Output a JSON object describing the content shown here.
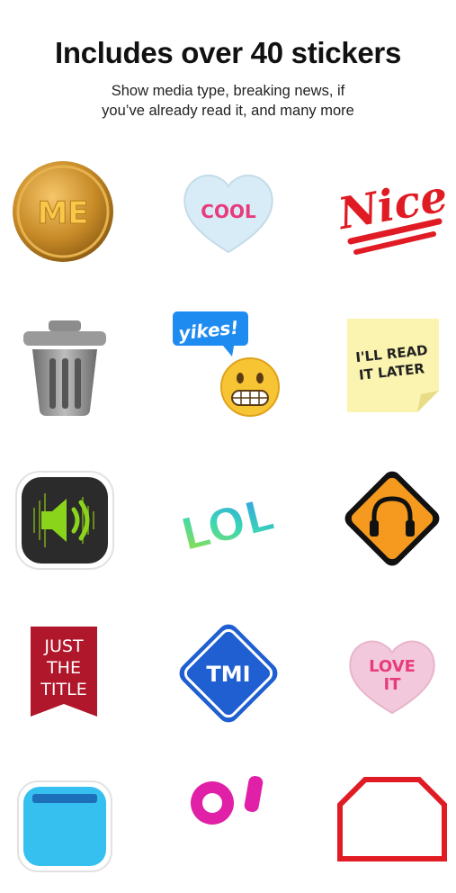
{
  "header": {
    "title": "Includes over 40 stickers",
    "subtitle_line1": "Show media type, breaking news, if",
    "subtitle_line2": "you’ve already read it, and many more"
  },
  "stickers": {
    "me": {
      "text": "ME",
      "icon": "gold-medal-icon"
    },
    "cool": {
      "text": "COOL",
      "icon": "candy-heart-icon"
    },
    "nice": {
      "text": "Nice",
      "icon": "nice-stamp-icon"
    },
    "trash": {
      "icon": "trash-can-icon"
    },
    "yikes": {
      "text": "yikes!",
      "icon": "grimace-emoji-icon"
    },
    "read_later": {
      "line1": "I'LL READ",
      "line2": "IT LATER",
      "icon": "sticky-note-icon"
    },
    "audio": {
      "icon": "speaker-icon"
    },
    "lol": {
      "text": "LOL",
      "icon": "lol-text-icon"
    },
    "headphones": {
      "icon": "headphones-sign-icon"
    },
    "just_the_title": {
      "line1": "JUST",
      "line2": "THE",
      "line3": "TITLE",
      "icon": "bookmark-ribbon-icon"
    },
    "tmi": {
      "text": "TMI",
      "icon": "tmi-sign-icon"
    },
    "love_it": {
      "line1": "LOVE",
      "line2": "IT",
      "icon": "candy-heart-icon"
    },
    "partial_blue": {
      "icon": "blue-window-icon"
    },
    "partial_magenta": {
      "icon": "magenta-sticker-icon"
    },
    "partial_red": {
      "icon": "stop-sign-icon"
    }
  },
  "colors": {
    "gold": "#c88a22",
    "pink": "#e83a7c",
    "red": "#e01b24",
    "yellow_note": "#fbf3b0",
    "orange_sign": "#f59a1e",
    "blue_sign": "#1f5fd1",
    "crimson_ribbon": "#b0172b"
  }
}
